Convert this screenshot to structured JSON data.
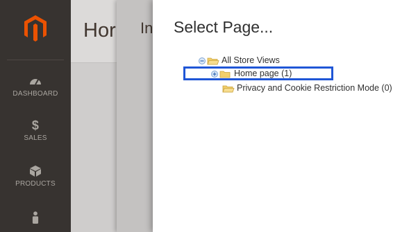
{
  "sidebar": {
    "items": [
      {
        "label": "DASHBOARD",
        "icon": "dashboard-gauge-icon"
      },
      {
        "label": "SALES",
        "icon": "dollar-icon"
      },
      {
        "label": "PRODUCTS",
        "icon": "box-icon"
      },
      {
        "label": "",
        "icon": "customer-person-icon"
      }
    ]
  },
  "page": {
    "title": "Hor"
  },
  "back_modal": {
    "title": "In"
  },
  "select_page_modal": {
    "title": "Select Page...",
    "tree": {
      "root_label": "All Store Views",
      "children": [
        {
          "label": "Home page (1)",
          "highlighted": true
        },
        {
          "label": "Privacy and Cookie Restriction Mode (0)",
          "highlighted": false
        }
      ]
    }
  },
  "colors": {
    "sidebar_bg": "#373330",
    "logo_orange": "#eb5202",
    "highlight_blue": "#1f56d6",
    "folder_yellow": "#f2cf6b"
  }
}
